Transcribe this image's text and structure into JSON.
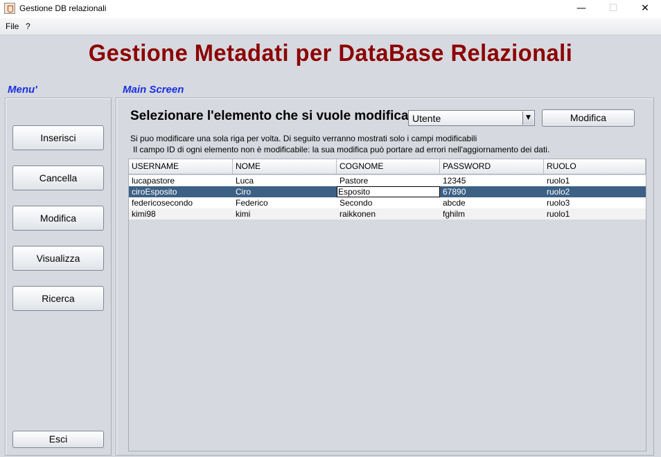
{
  "window": {
    "title": "Gestione DB relazionali",
    "minimize": "—",
    "maximize": "☐",
    "close": "✕"
  },
  "menubar": [
    "File",
    "?"
  ],
  "heading": "Gestione Metadati per DataBase Relazionali",
  "sidebar": {
    "label": "Menu'",
    "buttons": [
      "Inserisci",
      "Cancella",
      "Modifica",
      "Visualizza",
      "Ricerca"
    ],
    "exit": "Esci"
  },
  "main": {
    "label": "Main Screen",
    "prompt": "Selezionare l'elemento che si vuole modificare :",
    "select_value": "Utente",
    "select_arrow": "▼",
    "edit_button": "Modifica",
    "info_line1": "Si puo modificare una sola riga per volta. Di seguito verranno mostrati solo i campi modificabili",
    "info_line2": "Il campo ID di ogni elemento non è modificabile: la sua modifica può portare ad errori nell'aggiornamento dei dati."
  },
  "table": {
    "headers": [
      "USERNAME",
      "NOME",
      "COGNOME",
      "PASSWORD",
      "RUOLO"
    ],
    "rows": [
      [
        "lucapastore",
        "Luca",
        "Pastore",
        "12345",
        "ruolo1"
      ],
      [
        "ciroEsposito",
        "Ciro",
        "Esposito",
        "67890",
        "ruolo2"
      ],
      [
        "federicosecondo",
        "Federico",
        "Secondo",
        "abcde",
        "ruolo3"
      ],
      [
        "kimi98",
        "kimi",
        "raikkonen",
        "fghilm",
        "ruolo1"
      ]
    ],
    "selected_row": 1,
    "editing_column": 2
  },
  "colors": {
    "heading": "#8b0000",
    "section_label": "#1a2fe0",
    "selection": "#3d6185",
    "background": "#d6d9df"
  }
}
